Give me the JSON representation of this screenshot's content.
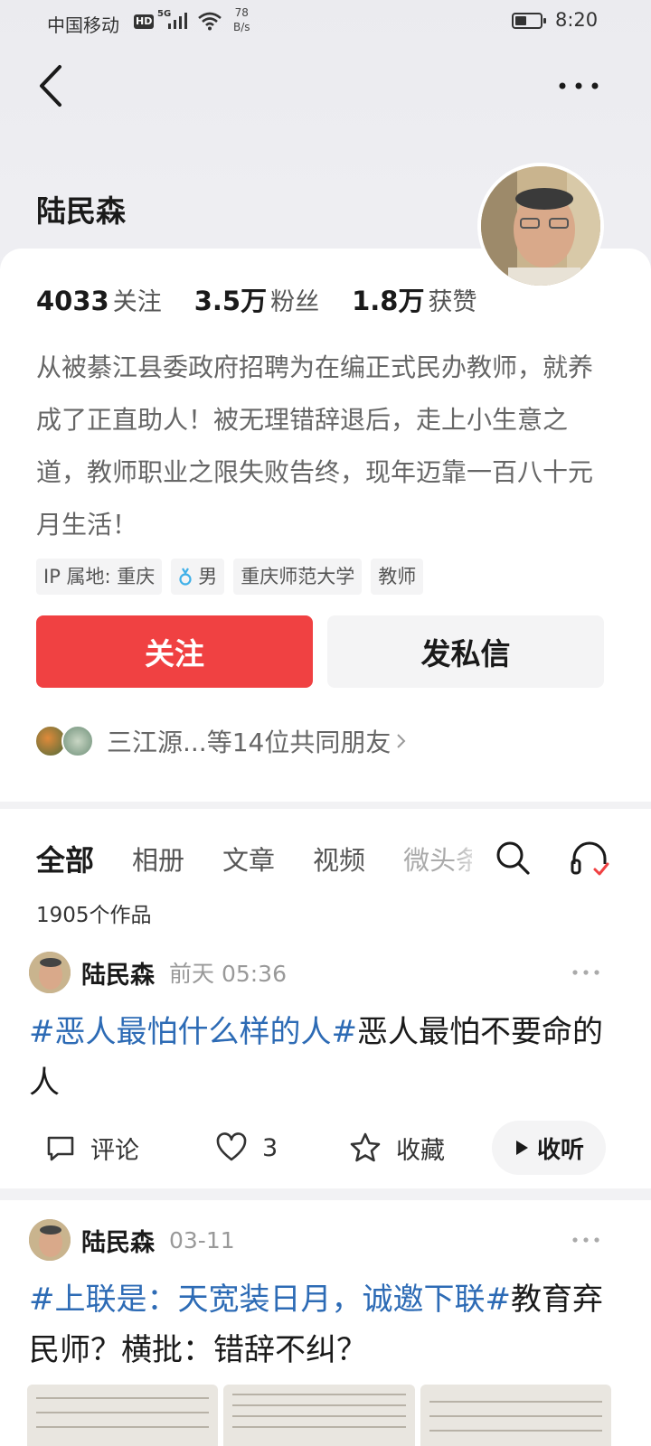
{
  "status_bar": {
    "carrier": "中国移动",
    "hd": "HD",
    "network": "5G",
    "speed_value": "78",
    "speed_unit": "B/s",
    "time": "8:20"
  },
  "profile": {
    "name": "陆民森",
    "stats": [
      {
        "value": "4033",
        "label": "关注"
      },
      {
        "value": "3.5万",
        "label": "粉丝"
      },
      {
        "value": "1.8万",
        "label": "获赞"
      }
    ],
    "bio": "从被綦江县委政府招聘为在编正式民办教师，就养成了正直助人！被无理错辞退后，走上小生意之道，教师职业之限失败告终，现年迈靠一百八十元月生活！",
    "tags": [
      "IP 属地: 重庆",
      "男",
      "重庆师范大学",
      "教师"
    ],
    "follow_label": "关注",
    "message_label": "发私信",
    "mutual_friends": "三江源...等14位共同朋友"
  },
  "tabs": {
    "items": [
      "全部",
      "相册",
      "文章",
      "视频",
      "微头条"
    ],
    "active_index": 0,
    "works_count": "1905个作品"
  },
  "posts": [
    {
      "author": "陆民森",
      "time": "前天  05:36",
      "hashtag": "#恶人最怕什么样的人#",
      "text": "恶人最怕不要命的人",
      "comment_label": "评论",
      "like_count": "3",
      "favorite_label": "收藏",
      "listen_label": "收听"
    },
    {
      "author": "陆民森",
      "time": "03-11",
      "hashtag": "#上联是：天宽装日月，诚邀下联#",
      "text": "教育弃民师？横批：错辞不纠？"
    }
  ],
  "colors": {
    "accent_red": "#f04142",
    "hashtag_blue": "#2d6bb5",
    "male_icon_blue": "#3fb0e8"
  }
}
